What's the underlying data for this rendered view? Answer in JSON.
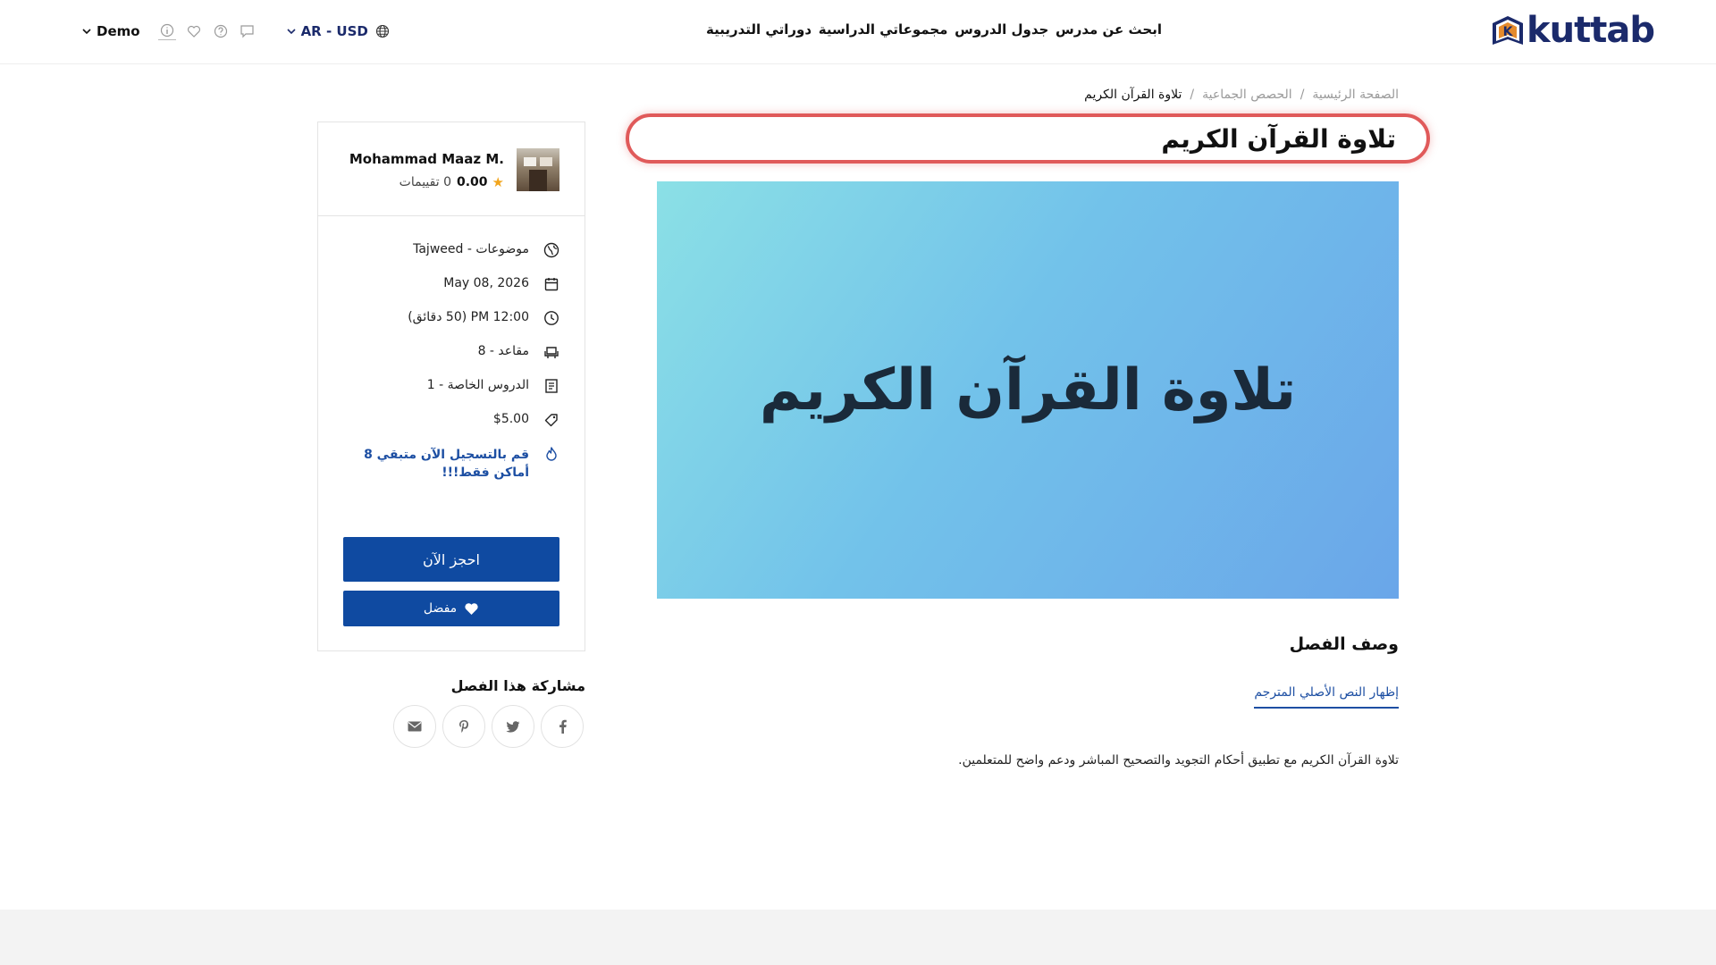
{
  "header": {
    "logo_text": "kuttab",
    "logo_mark": "K",
    "nav": [
      {
        "label": "ابحث عن مدرس"
      },
      {
        "label": "جدول الدروس"
      },
      {
        "label": "مجموعاتي الدراسية"
      },
      {
        "label": "دوراتي التدريبية"
      }
    ],
    "user_label": "Demo",
    "lang_label": "AR - USD"
  },
  "breadcrumb": {
    "home": "الصفحة الرئيسية",
    "section": "الحصص الجماعية",
    "current": "تلاوة القرآن الكريم",
    "separator": "/"
  },
  "class": {
    "title": "تلاوة القرآن الكريم",
    "banner_text": "تلاوة القرآن الكريم",
    "description_title": "وصف الفصل",
    "translate_link": "إظهار النص الأصلي المترجم",
    "description": "تلاوة القرآن الكريم مع تطبيق أحكام التجويد والتصحيح المباشر ودعم واضح للمتعلمين."
  },
  "sidebar": {
    "teacher_name": "Mohammad Maaz M.",
    "rating_score": "0.00",
    "rating_count": "0 تقييمات",
    "star": "★",
    "info": {
      "topic": "موضوعات - Tajweed",
      "date": "May 08, 2026",
      "time": "12:00 PM (50 دقائق)",
      "seats": "مقاعد - 8",
      "private_lessons": "الدروس الخاصة - 1",
      "price": "$5.00",
      "alert": "قم بالتسجيل الآن متبقي 8 أماكن فقط!!!"
    },
    "book_button": "احجز الآن",
    "favorite_button": "مفضل"
  },
  "share": {
    "title": "مشاركة هذا الفصل"
  },
  "colors": {
    "brand": "#1b2a6b",
    "accent": "#0f4aa1",
    "title_outline": "#e05a5a",
    "star": "#f2a51d"
  }
}
